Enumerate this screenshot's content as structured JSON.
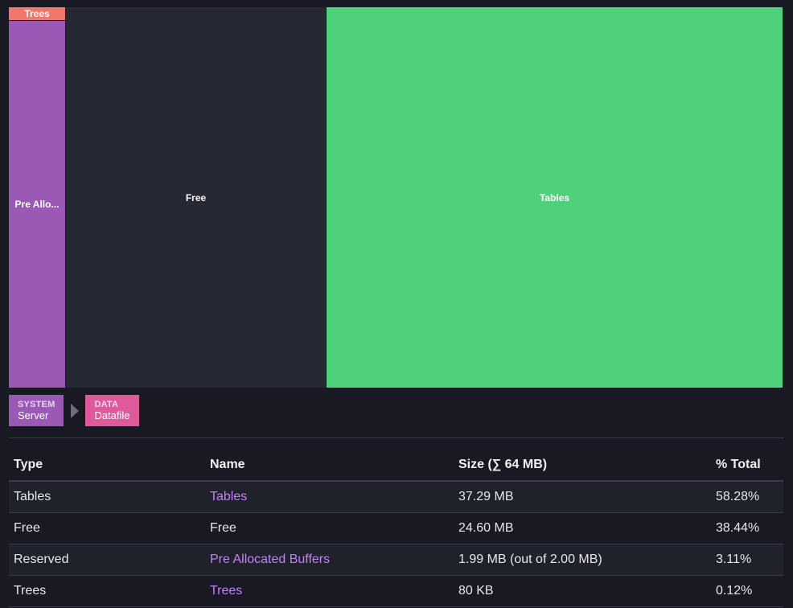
{
  "treemap": {
    "tiles": {
      "trees": "Trees",
      "prealloc": "Pre Allo...",
      "free": "Free",
      "tables": "Tables"
    },
    "colors": {
      "trees": "#f0776b",
      "prealloc": "#9b59b6",
      "free": "#262833",
      "tables": "#4fd17b"
    }
  },
  "breadcrumb": {
    "items": [
      {
        "kind": "SYSTEM",
        "label": "Server",
        "color": "#9b59b6"
      },
      {
        "kind": "DATA",
        "label": "Datafile",
        "color": "#de5a9a"
      }
    ],
    "separator_icon": "chevron-right-icon"
  },
  "table": {
    "headers": {
      "type": "Type",
      "name": "Name",
      "size": "Size (∑ 64 MB)",
      "percent": "% Total"
    },
    "rows": [
      {
        "type": "Tables",
        "name": "Tables",
        "name_is_link": true,
        "size": "37.29 MB",
        "percent": "58.28%"
      },
      {
        "type": "Free",
        "name": "Free",
        "name_is_link": false,
        "size": "24.60 MB",
        "percent": "38.44%"
      },
      {
        "type": "Reserved",
        "name": "Pre Allocated Buffers",
        "name_is_link": true,
        "size": "1.99 MB (out of 2.00 MB)",
        "percent": "3.11%"
      },
      {
        "type": "Trees",
        "name": "Trees",
        "name_is_link": true,
        "size": "80 KB",
        "percent": "0.12%"
      }
    ]
  }
}
